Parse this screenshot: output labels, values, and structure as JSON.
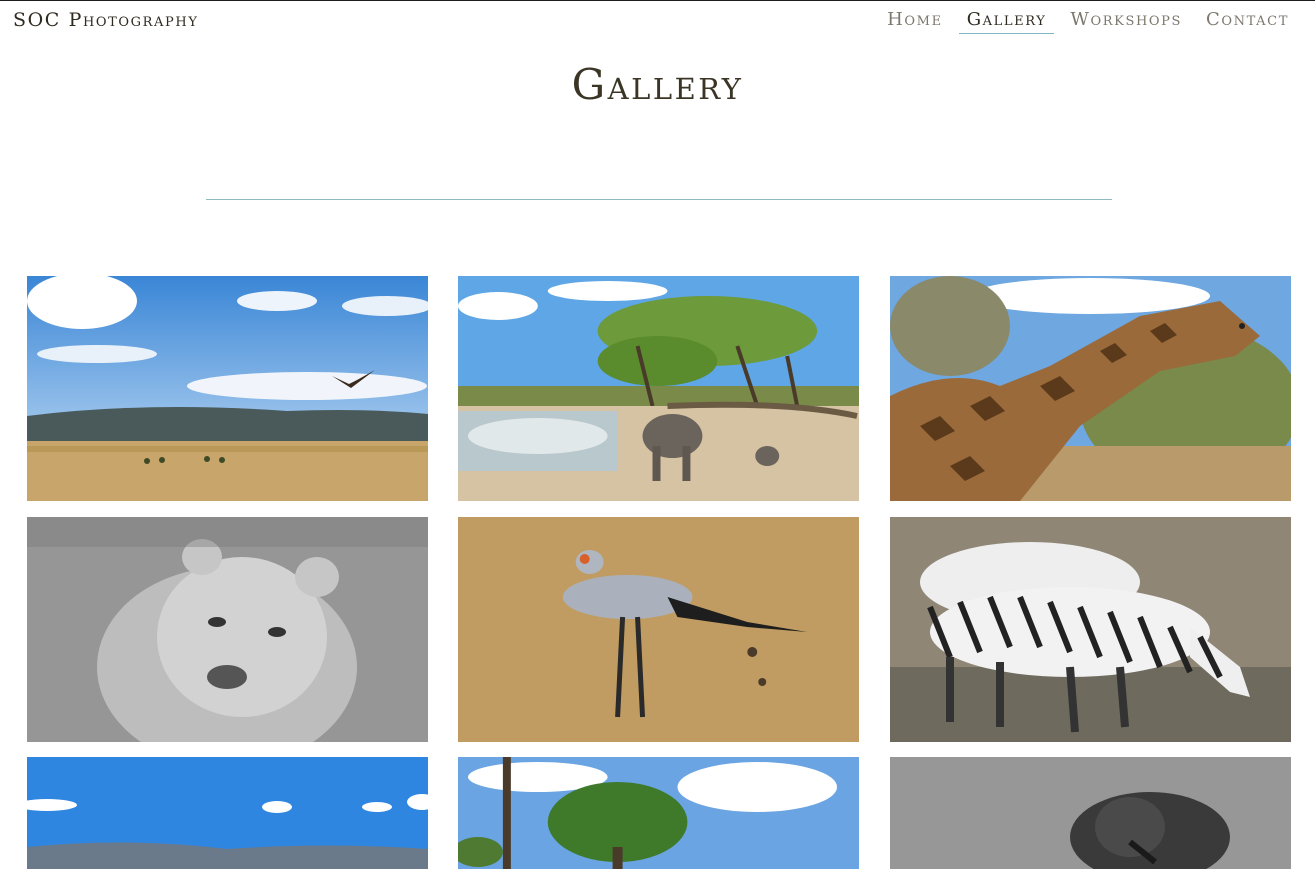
{
  "header": {
    "brand": "SOC Photography",
    "nav": [
      {
        "label": "Home",
        "active": false
      },
      {
        "label": "Gallery",
        "active": true
      },
      {
        "label": "Workshops",
        "active": false
      },
      {
        "label": "Contact",
        "active": false
      }
    ]
  },
  "main": {
    "title": "Gallery"
  },
  "colors": {
    "accent_line": "#8fbcc2",
    "text": "#2f2a20",
    "nav_inactive": "#7d786d"
  },
  "gallery": {
    "photos": [
      {
        "subject": "eagle-over-savanna"
      },
      {
        "subject": "elephants-at-waterhole"
      },
      {
        "subject": "giraffe"
      },
      {
        "subject": "lioness-bw"
      },
      {
        "subject": "secretary-bird"
      },
      {
        "subject": "zebras-drinking"
      },
      {
        "subject": "crater-landscape"
      },
      {
        "subject": "acacia-tree"
      },
      {
        "subject": "bird-bw"
      }
    ]
  }
}
